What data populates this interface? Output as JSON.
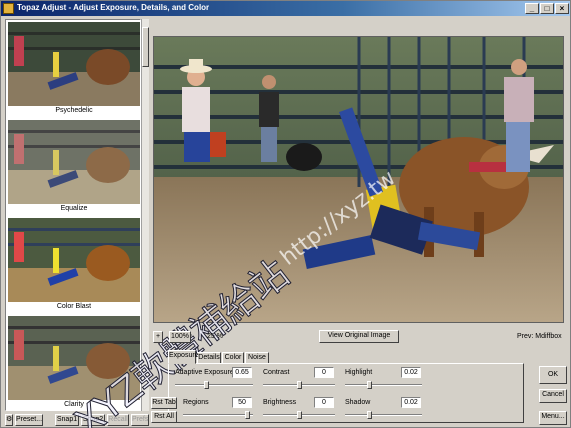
{
  "window": {
    "title": "Topaz Adjust - Adjust Exposure, Details, and Color",
    "controls": [
      "_",
      "□",
      "×"
    ]
  },
  "presets": [
    {
      "label": "Psychedelic"
    },
    {
      "label": "Equalize"
    },
    {
      "label": "Color Blast"
    },
    {
      "label": "Clarity"
    }
  ],
  "bottom_left": {
    "preset_label": "Preset...",
    "snap1": "Snap1",
    "snap2": "Snap2",
    "recall": "Recall",
    "prefs": "Prefs"
  },
  "toolbar": {
    "zoom_in": "+",
    "zoom_100": "100%",
    "zoom_level": "25 %",
    "view_original": "View Original Image",
    "preview_mode": "Prev: Mdiffbox"
  },
  "tabs": [
    "Exposure",
    "Details",
    "Color",
    "Noise"
  ],
  "side_buttons": {
    "reset_tab": "Rst Tab",
    "reset_all": "Rst All"
  },
  "controls": {
    "adaptive_exposure": {
      "label": "Adaptive Exposure",
      "value": "0.65",
      "fraction": 0.4
    },
    "contrast": {
      "label": "Contrast",
      "value": "0",
      "fraction": 0.5
    },
    "highlight": {
      "label": "Highlight",
      "value": "0.02",
      "fraction": 0.3
    },
    "regions": {
      "label": "Regions",
      "value": "50",
      "fraction": 0.95
    },
    "brightness": {
      "label": "Brightness",
      "value": "0",
      "fraction": 0.5
    },
    "shadow": {
      "label": "Shadow",
      "value": "0.02",
      "fraction": 0.3
    }
  },
  "action_buttons": {
    "ok": "OK",
    "cancel": "Cancel",
    "menu": "Menu..."
  },
  "watermark": {
    "main": "XYZ軟體補給站",
    "url": "http://xyz.tw"
  }
}
